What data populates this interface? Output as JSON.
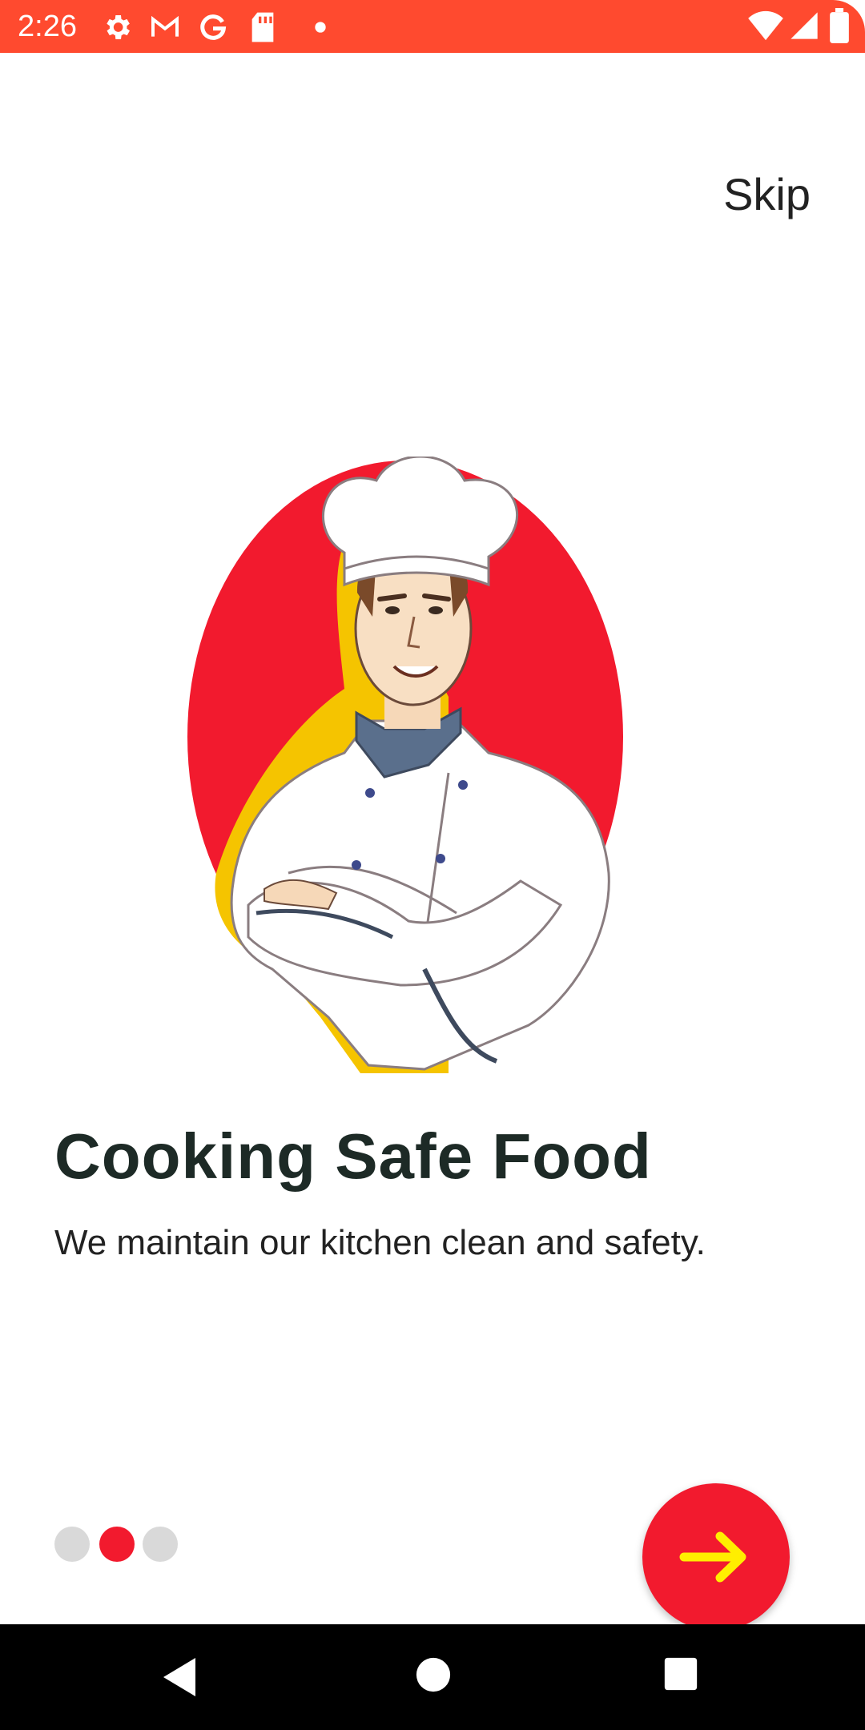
{
  "status_bar": {
    "time": "2:26",
    "icons": [
      "gear-icon",
      "gmail-icon",
      "google-icon",
      "sd-card-icon",
      "dot-icon",
      "wifi-icon",
      "signal-icon",
      "battery-icon"
    ]
  },
  "onboarding": {
    "skip_label": "Skip",
    "title": "Cooking Safe Food",
    "subtitle": "We maintain our kitchen clean and safety.",
    "page_indicator": {
      "total": 3,
      "current": 2
    },
    "next_button_icon": "arrow-right-icon"
  },
  "colors": {
    "status_bar": "#ff4a2f",
    "accent": "#f21a2e",
    "arrow": "#ffee00",
    "dot_inactive": "#d9d9d9",
    "title": "#1d2a26"
  },
  "nav_bar": {
    "icons": [
      "back-icon",
      "home-icon",
      "recents-icon"
    ]
  }
}
